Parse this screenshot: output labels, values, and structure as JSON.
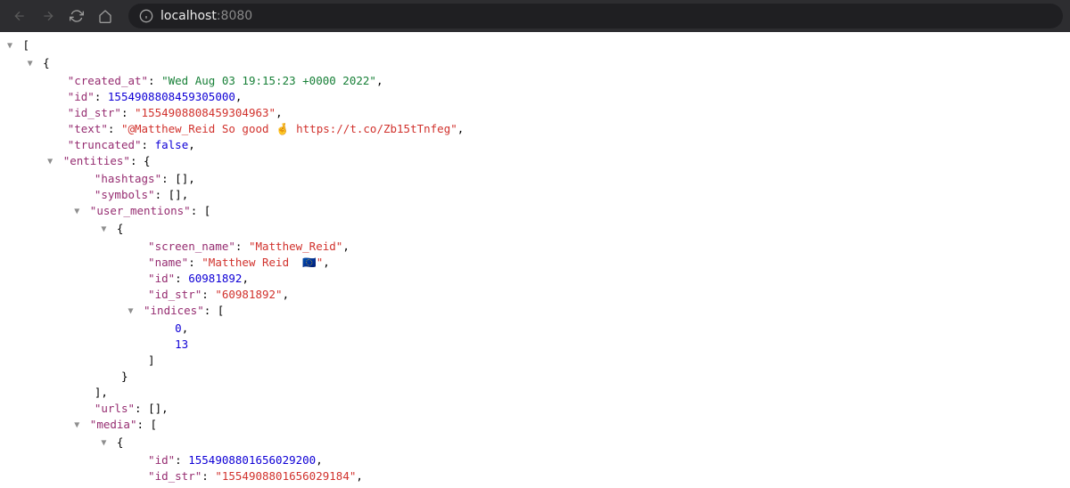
{
  "browser": {
    "host": "localhost",
    "port": ":8080"
  },
  "json": {
    "open_bracket": "[",
    "open_brace": "{",
    "created_at_key": "\"created_at\"",
    "created_at_val": "\"Wed Aug 03 19:15:23 +0000 2022\"",
    "id_key": "\"id\"",
    "id_val": "1554908808459305000",
    "id_str_key": "\"id_str\"",
    "id_str_val": "\"1554908808459304963\"",
    "text_key": "\"text\"",
    "text_val": "\"@Matthew_Reid So good 🤞 https://t.co/Zb15tTnfeg\"",
    "truncated_key": "\"truncated\"",
    "truncated_val": "false",
    "entities_key": "\"entities\"",
    "hashtags_key": "\"hashtags\"",
    "hashtags_val": "[]",
    "symbols_key": "\"symbols\"",
    "symbols_val": "[]",
    "user_mentions_key": "\"user_mentions\"",
    "screen_name_key": "\"screen_name\"",
    "screen_name_val": "\"Matthew_Reid\"",
    "name_key": "\"name\"",
    "name_val": "\"Matthew Reid  🇪🇺\"",
    "um_id_key": "\"id\"",
    "um_id_val": "60981892",
    "um_idstr_key": "\"id_str\"",
    "um_idstr_val": "\"60981892\"",
    "indices_key": "\"indices\"",
    "idx0": "0",
    "idx1": "13",
    "urls_key": "\"urls\"",
    "urls_val": "[]",
    "media_key": "\"media\"",
    "media_id_key": "\"id\"",
    "media_id_val": "1554908801656029200",
    "media_idstr_key": "\"id_str\"",
    "media_idstr_val": "\"1554908801656029184\"",
    "arrow": "▼",
    "close_bracket": "]",
    "close_brace": "}",
    "comma": ",",
    "colon": ": ",
    "open_brace_sym": "{",
    "open_bracket_sym": "["
  }
}
